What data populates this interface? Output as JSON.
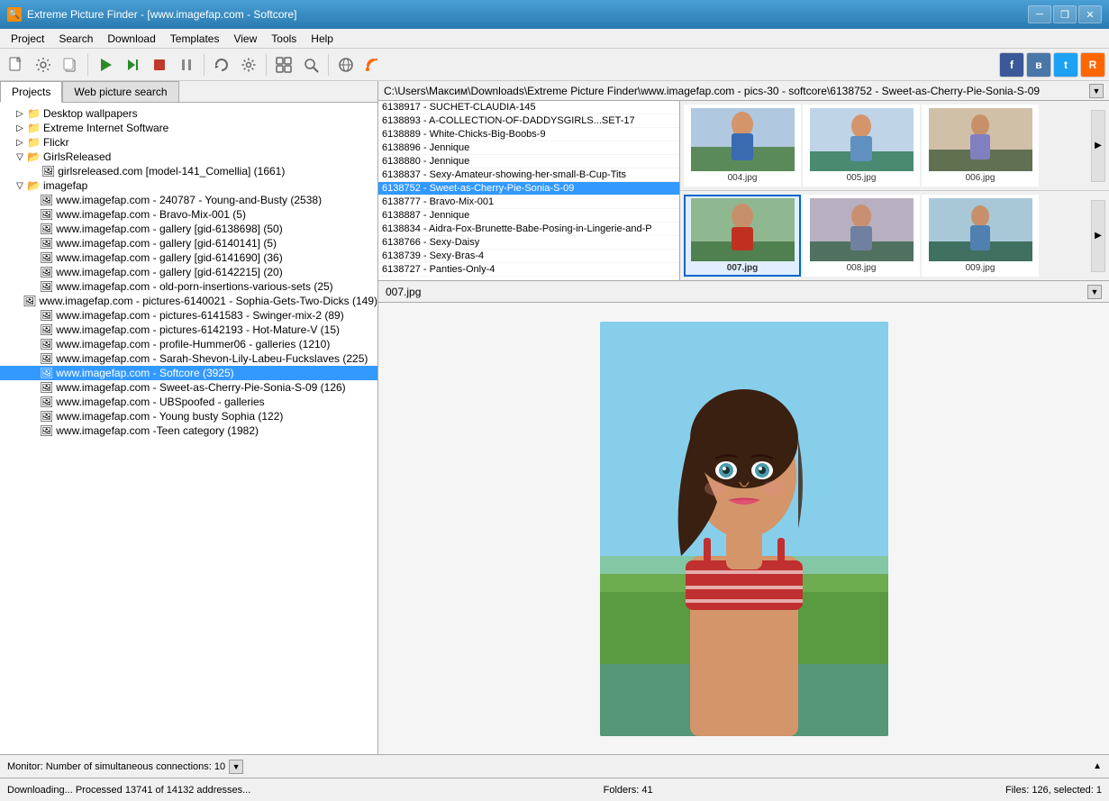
{
  "app": {
    "title": "Extreme Picture Finder - [www.imagefap.com - Softcore]",
    "icon_label": "EPF"
  },
  "titlebar": {
    "minimize_label": "─",
    "restore_label": "❐",
    "close_label": "✕"
  },
  "menubar": {
    "items": [
      {
        "id": "project",
        "label": "Project"
      },
      {
        "id": "search",
        "label": "Search"
      },
      {
        "id": "download",
        "label": "Download"
      },
      {
        "id": "templates",
        "label": "Templates"
      },
      {
        "id": "view",
        "label": "View"
      },
      {
        "id": "tools",
        "label": "Tools"
      },
      {
        "id": "help",
        "label": "Help"
      }
    ]
  },
  "tabs": {
    "projects_label": "Projects",
    "web_picture_search_label": "Web picture search"
  },
  "path": {
    "value": "C:\\Users\\Максим\\Downloads\\Extreme Picture Finder\\www.imagefap.com - pics-30 - softcore\\6138752 - Sweet-as-Cherry-Pie-Sonia-S-09"
  },
  "tree": {
    "items": [
      {
        "label": "Desktop wallpapers",
        "level": 1,
        "expanded": false,
        "type": "folder"
      },
      {
        "label": "Extreme Internet Software",
        "level": 1,
        "expanded": false,
        "type": "folder"
      },
      {
        "label": "Flickr",
        "level": 1,
        "expanded": false,
        "type": "folder"
      },
      {
        "label": "GirlsReleased",
        "level": 1,
        "expanded": true,
        "type": "folder"
      },
      {
        "label": "girlsreleased.com [model-141_Comellia] (1661)",
        "level": 2,
        "expanded": false,
        "type": "item"
      },
      {
        "label": "imagefap",
        "level": 1,
        "expanded": true,
        "type": "folder"
      },
      {
        "label": "www.imagefap.com - 240787 - Young-and-Busty (2538)",
        "level": 2,
        "expanded": false,
        "type": "item"
      },
      {
        "label": "www.imagefap.com - Bravo-Mix-001 (5)",
        "level": 2,
        "expanded": false,
        "type": "item"
      },
      {
        "label": "www.imagefap.com - gallery [gid-6138698] (50)",
        "level": 2,
        "expanded": false,
        "type": "item"
      },
      {
        "label": "www.imagefap.com - gallery [gid-6140141] (5)",
        "level": 2,
        "expanded": false,
        "type": "item"
      },
      {
        "label": "www.imagefap.com - gallery [gid-6141690] (36)",
        "level": 2,
        "expanded": false,
        "type": "item"
      },
      {
        "label": "www.imagefap.com - gallery [gid-6142215] (20)",
        "level": 2,
        "expanded": false,
        "type": "item"
      },
      {
        "label": "www.imagefap.com - old-porn-insertions-various-sets (25)",
        "level": 2,
        "expanded": false,
        "type": "item"
      },
      {
        "label": "www.imagefap.com - pictures-6140021 - Sophia-Gets-Two-Dicks (149)",
        "level": 2,
        "expanded": false,
        "type": "item"
      },
      {
        "label": "www.imagefap.com - pictures-6141583 - Swinger-mix-2 (89)",
        "level": 2,
        "expanded": false,
        "type": "item"
      },
      {
        "label": "www.imagefap.com - pictures-6142193 - Hot-Mature-V (15)",
        "level": 2,
        "expanded": false,
        "type": "item"
      },
      {
        "label": "www.imagefap.com - profile-Hummer06 - galleries (1210)",
        "level": 2,
        "expanded": false,
        "type": "item"
      },
      {
        "label": "www.imagefap.com - Sarah-Shevon-Lily-Labeu-Fuckslaves (225)",
        "level": 2,
        "expanded": false,
        "type": "item"
      },
      {
        "label": "www.imagefap.com - Softcore (3925)",
        "level": 2,
        "expanded": false,
        "type": "item",
        "selected": true
      },
      {
        "label": "www.imagefap.com - Sweet-as-Cherry-Pie-Sonia-S-09 (126)",
        "level": 2,
        "expanded": false,
        "type": "item"
      },
      {
        "label": "www.imagefap.com - UBSpoofed - galleries",
        "level": 2,
        "expanded": false,
        "type": "item"
      },
      {
        "label": "www.imagefap.com - Young busty Sophia (122)",
        "level": 2,
        "expanded": false,
        "type": "item"
      },
      {
        "label": "www.imagefap.com -Teen category (1982)",
        "level": 2,
        "expanded": false,
        "type": "item"
      }
    ]
  },
  "file_list": {
    "items": [
      {
        "label": "6138917 - SUCHET-CLAUDIA-145"
      },
      {
        "label": "6138893 - A-COLLECTION-OF-DADDYSGIRLS...SET-17"
      },
      {
        "label": "6138889 - White-Chicks-Big-Boobs-9"
      },
      {
        "label": "6138896 - Jennique"
      },
      {
        "label": "6138880 - Jennique"
      },
      {
        "label": "6138837 - Sexy-Amateur-showing-her-small-B-Cup-Tits"
      },
      {
        "label": "6138752 - Sweet-as-Cherry-Pie-Sonia-S-09",
        "selected": true
      },
      {
        "label": "6138777 - Bravo-Mix-001"
      },
      {
        "label": "6138887 - Jennique"
      },
      {
        "label": "6138834 - Aidra-Fox-Brunette-Babe-Posing-in-Lingerie-and-P"
      },
      {
        "label": "6138766 - Sexy-Daisy"
      },
      {
        "label": "6138739 - Sexy-Bras-4"
      },
      {
        "label": "6138727 - Panties-Only-4"
      }
    ]
  },
  "thumbnails_row1": [
    {
      "label": "004.jpg",
      "selected": false,
      "color": "thumb-bg-1"
    },
    {
      "label": "005.jpg",
      "selected": false,
      "color": "thumb-bg-2"
    },
    {
      "label": "006.jpg",
      "selected": false,
      "color": "thumb-bg-3"
    }
  ],
  "thumbnails_row2": [
    {
      "label": "007.jpg",
      "selected": true,
      "color": "thumb-bg-4"
    },
    {
      "label": "008.jpg",
      "selected": false,
      "color": "thumb-bg-5"
    },
    {
      "label": "009.jpg",
      "selected": false,
      "color": "thumb-bg-6"
    }
  ],
  "preview": {
    "filename": "007.jpg"
  },
  "status_bar_1": {
    "text": "Monitor: Number of simultaneous connections: 10",
    "arrow": "▼"
  },
  "status_bar_2": {
    "left": "Downloading... Processed 13741 of 14132 addresses...",
    "middle": "Folders: 41",
    "right": "Files: 126, selected: 1"
  },
  "toolbar": {
    "buttons": [
      {
        "name": "new-project",
        "icon": "📄"
      },
      {
        "name": "properties",
        "icon": "🔧"
      },
      {
        "name": "clipboard",
        "icon": "📋"
      },
      {
        "name": "play",
        "icon": "▶"
      },
      {
        "name": "play-alt",
        "icon": "▷"
      },
      {
        "name": "stop",
        "icon": "⏹"
      },
      {
        "name": "pause",
        "icon": "⏸"
      },
      {
        "name": "refresh",
        "icon": "↺"
      },
      {
        "name": "settings-gear",
        "icon": "⚙"
      }
    ],
    "social": [
      {
        "name": "facebook",
        "icon": "f",
        "color": "#3b5998"
      },
      {
        "name": "vk",
        "icon": "в",
        "color": "#4a76a8"
      },
      {
        "name": "twitter",
        "icon": "t",
        "color": "#1da1f2"
      },
      {
        "name": "rss",
        "icon": "R",
        "color": "#f60"
      }
    ]
  }
}
